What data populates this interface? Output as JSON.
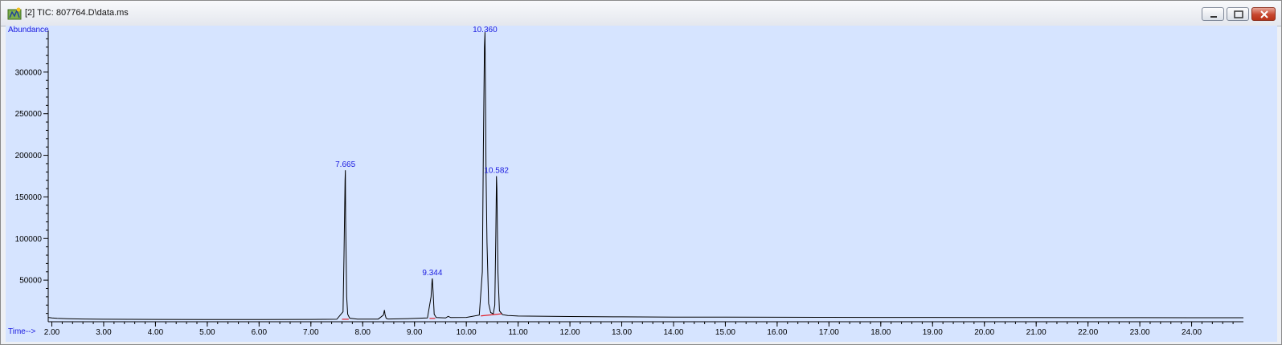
{
  "window": {
    "title": "[2] TIC: 807764.D\\data.ms",
    "icon": "chromatogram-app-icon",
    "controls": [
      "minimize",
      "maximize",
      "close"
    ]
  },
  "colors": {
    "plot_background": "#d6e4ff",
    "trace": "#000000",
    "peak_labels": "#1a1adf",
    "baseline_marks": "#e0202a"
  },
  "chart_data": {
    "type": "line",
    "xlabel": "Time-->",
    "ylabel": "Abundance",
    "xlim": [
      1.93,
      25.0
    ],
    "ylim": [
      0,
      350000
    ],
    "x_ticks": [
      "2.00",
      "3.00",
      "4.00",
      "5.00",
      "6.00",
      "7.00",
      "8.00",
      "9.00",
      "10.00",
      "11.00",
      "12.00",
      "13.00",
      "14.00",
      "15.00",
      "16.00",
      "17.00",
      "18.00",
      "19.00",
      "20.00",
      "21.00",
      "22.00",
      "23.00",
      "24.00"
    ],
    "y_ticks": [
      "50000",
      "100000",
      "150000",
      "200000",
      "250000",
      "300000"
    ],
    "grid": false,
    "peaks": [
      {
        "label": "7.665",
        "x": 7.665,
        "y": 182000
      },
      {
        "label": "9.344",
        "x": 9.344,
        "y": 52000
      },
      {
        "label": "10.360",
        "x": 10.36,
        "y": 348000
      },
      {
        "label": "10.582",
        "x": 10.582,
        "y": 175000
      }
    ],
    "series": [
      {
        "x": [
          1.93,
          2.0,
          2.1,
          2.3,
          2.6,
          3.0,
          4.0,
          5.0,
          6.0,
          7.0,
          7.5,
          7.62,
          7.64,
          7.66,
          7.665,
          7.67,
          7.69,
          7.71,
          7.75,
          7.9,
          8.3,
          8.4,
          8.42,
          8.43,
          8.45,
          8.47,
          8.5,
          8.8,
          9.25,
          9.32,
          9.34,
          9.344,
          9.36,
          9.38,
          9.42,
          9.6,
          9.65,
          9.7,
          10.0,
          10.25,
          10.31,
          10.33,
          10.35,
          10.36,
          10.37,
          10.38,
          10.4,
          10.43,
          10.47,
          10.52,
          10.55,
          10.57,
          10.582,
          10.59,
          10.61,
          10.64,
          10.7,
          10.8,
          11.0,
          12.0,
          13.0,
          14.0,
          15.0,
          16.0,
          17.0,
          18.0,
          19.0,
          20.0,
          21.0,
          22.0,
          23.0,
          24.0,
          25.0
        ],
        "y": [
          5200,
          4600,
          4100,
          3700,
          3300,
          3000,
          2800,
          2600,
          2700,
          2800,
          3000,
          12000,
          80000,
          170000,
          182000,
          125000,
          30000,
          9000,
          4200,
          3200,
          3200,
          8000,
          14000,
          9000,
          4500,
          3500,
          3300,
          3600,
          4500,
          30000,
          50000,
          52000,
          35000,
          9000,
          5000,
          4500,
          6500,
          5000,
          5200,
          8000,
          60000,
          210000,
          330000,
          348000,
          275000,
          180000,
          95000,
          22000,
          11000,
          9500,
          20000,
          105000,
          175000,
          160000,
          60000,
          13000,
          8500,
          7500,
          6800,
          6300,
          5900,
          5600,
          5500,
          5400,
          5300,
          5200,
          5200,
          5100,
          5000,
          4900,
          4900,
          4800,
          4800
        ]
      }
    ],
    "baseline_segments": [
      {
        "x": [
          7.6,
          7.73
        ],
        "y": [
          3000,
          3000
        ]
      },
      {
        "x": [
          9.29,
          9.4
        ],
        "y": [
          4000,
          4000
        ]
      },
      {
        "x": [
          10.28,
          10.68
        ],
        "y": [
          7000,
          9500
        ]
      }
    ]
  }
}
